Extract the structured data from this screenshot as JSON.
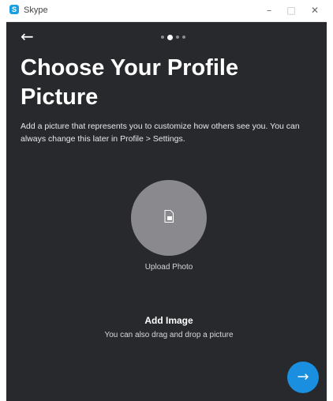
{
  "window": {
    "app_title": "Skype",
    "app_icon_glyph": "S",
    "controls": {
      "minimize": "–",
      "maximize": "□",
      "close": "✕"
    }
  },
  "nav": {
    "back_icon": "←",
    "pager": {
      "count": 4,
      "active_index": 1
    }
  },
  "content": {
    "title": "Choose Your Profile Picture",
    "description": "Add a picture that represents you to customize how others see you. You can always change this later in Profile > Settings.",
    "upload_label": "Upload Photo",
    "add_image_title": "Add Image",
    "add_image_subtitle": "You can also drag and drop a picture"
  },
  "next_button": {
    "icon": "→"
  },
  "colors": {
    "background": "#28292d",
    "accent": "#1a8fe0",
    "upload_circle": "#8a8a8e"
  }
}
